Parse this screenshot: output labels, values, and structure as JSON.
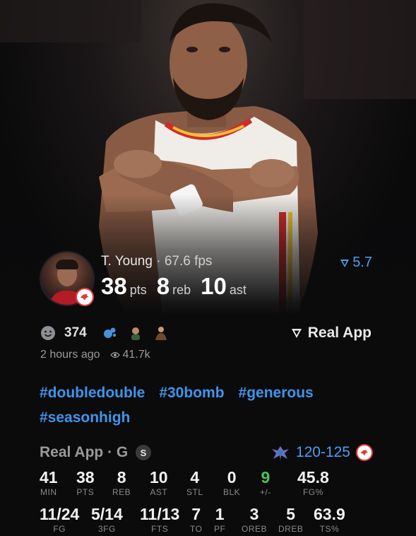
{
  "post": {
    "player_name": "T. Young",
    "separator": "·",
    "fantasy_points": "67.6 fps",
    "rating": "5.7",
    "stats": [
      {
        "value": "38",
        "unit": "pts"
      },
      {
        "value": "8",
        "unit": "reb"
      },
      {
        "value": "10",
        "unit": "ast"
      }
    ],
    "reaction_count": "374",
    "source": "Real App",
    "time_ago": "2 hours ago",
    "views": "41.7k",
    "hashtags": [
      "#doubledouble",
      "#30bomb",
      "#generous",
      "#seasonhigh"
    ]
  },
  "game": {
    "source": "Real App",
    "type": "G",
    "badge": "S",
    "score": "120-125"
  },
  "box_row1": [
    {
      "value": "41",
      "label": "MIN"
    },
    {
      "value": "38",
      "label": "PTS"
    },
    {
      "value": "8",
      "label": "REB"
    },
    {
      "value": "10",
      "label": "AST"
    },
    {
      "value": "4",
      "label": "STL"
    },
    {
      "value": "0",
      "label": "BLK"
    },
    {
      "value": "9",
      "label": "+/-"
    },
    {
      "value": "45.8",
      "label": "FG%"
    }
  ],
  "box_row2": [
    {
      "value": "11/24",
      "label": "FG"
    },
    {
      "value": "5/14",
      "label": "3FG"
    },
    {
      "value": "11/13",
      "label": "FTS"
    },
    {
      "value": "7",
      "label": "TO"
    },
    {
      "value": "1",
      "label": "PF"
    },
    {
      "value": "3",
      "label": "OREB"
    },
    {
      "value": "5",
      "label": "DREB"
    },
    {
      "value": "63.9",
      "label": "TS%"
    }
  ],
  "colors": {
    "accent": "#3f95ec",
    "positive": "#46c35a",
    "team": "#e03a3e"
  }
}
